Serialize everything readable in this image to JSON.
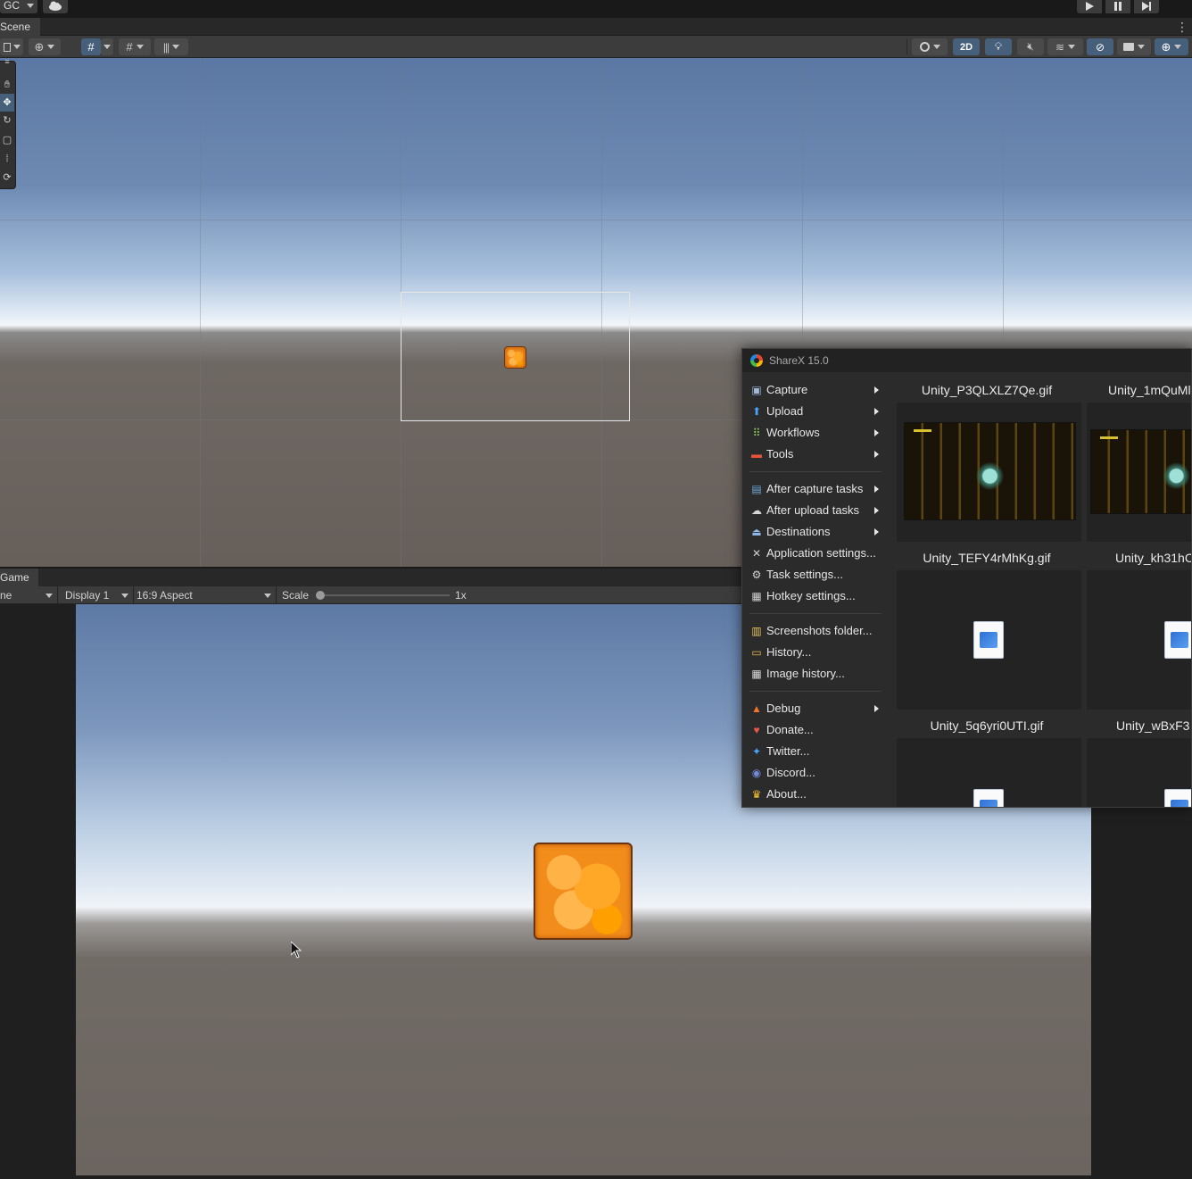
{
  "top_bar": {
    "account_label": "GC",
    "play_icon": "play-icon",
    "pause_icon": "pause-icon",
    "step_icon": "step-icon"
  },
  "scene": {
    "tab_label": "Scene",
    "toolbar": {
      "mode_2d_label": "2D"
    }
  },
  "game": {
    "tab_label": "Game",
    "mode_label": "ne",
    "display_label": "Display 1",
    "aspect_label": "16:9 Aspect",
    "scale_label": "Scale",
    "scale_value_label": "1x",
    "scale_value": 0.0
  },
  "sharex": {
    "title": "ShareX 15.0",
    "menu": [
      {
        "label": "Capture",
        "icon": "camera-icon",
        "submenu": true
      },
      {
        "label": "Upload",
        "icon": "upload-arrow-icon",
        "submenu": true
      },
      {
        "label": "Workflows",
        "icon": "grid-icon",
        "submenu": true
      },
      {
        "label": "Tools",
        "icon": "toolbox-icon",
        "submenu": true
      },
      {
        "label": "After capture tasks",
        "icon": "image-task-icon",
        "submenu": true
      },
      {
        "label": "After upload tasks",
        "icon": "cloud-icon",
        "submenu": true
      },
      {
        "label": "Destinations",
        "icon": "destination-icon",
        "submenu": true
      },
      {
        "label": "Application settings...",
        "icon": "wrench-icon",
        "submenu": false
      },
      {
        "label": "Task settings...",
        "icon": "gear-icon",
        "submenu": false
      },
      {
        "label": "Hotkey settings...",
        "icon": "keyboard-icon",
        "submenu": false
      },
      {
        "label": "Screenshots folder...",
        "icon": "folder-icon",
        "submenu": false
      },
      {
        "label": "History...",
        "icon": "history-icon",
        "submenu": false
      },
      {
        "label": "Image history...",
        "icon": "image-history-icon",
        "submenu": false
      },
      {
        "label": "Debug",
        "icon": "traffic-cone-icon",
        "submenu": true
      },
      {
        "label": "Donate...",
        "icon": "heart-icon",
        "submenu": false
      },
      {
        "label": "Twitter...",
        "icon": "twitter-icon",
        "submenu": false
      },
      {
        "label": "Discord...",
        "icon": "discord-icon",
        "submenu": false
      },
      {
        "label": "About...",
        "icon": "crown-icon",
        "submenu": false
      }
    ],
    "thumbnails": [
      {
        "name": "Unity_P3QLXLZ7Qe.gif",
        "kind": "preview"
      },
      {
        "name": "Unity_1mQuMl",
        "kind": "preview"
      },
      {
        "name": "Unity_TEFY4rMhKg.gif",
        "kind": "file"
      },
      {
        "name": "Unity_kh31hC",
        "kind": "file"
      },
      {
        "name": "Unity_5q6yri0UTI.gif",
        "kind": "file"
      },
      {
        "name": "Unity_wBxF3",
        "kind": "file"
      }
    ]
  },
  "colors": {
    "editor_panel": "#3c3c3c",
    "active_tool": "#46607c",
    "sprite_orange": "#f28c1a"
  }
}
